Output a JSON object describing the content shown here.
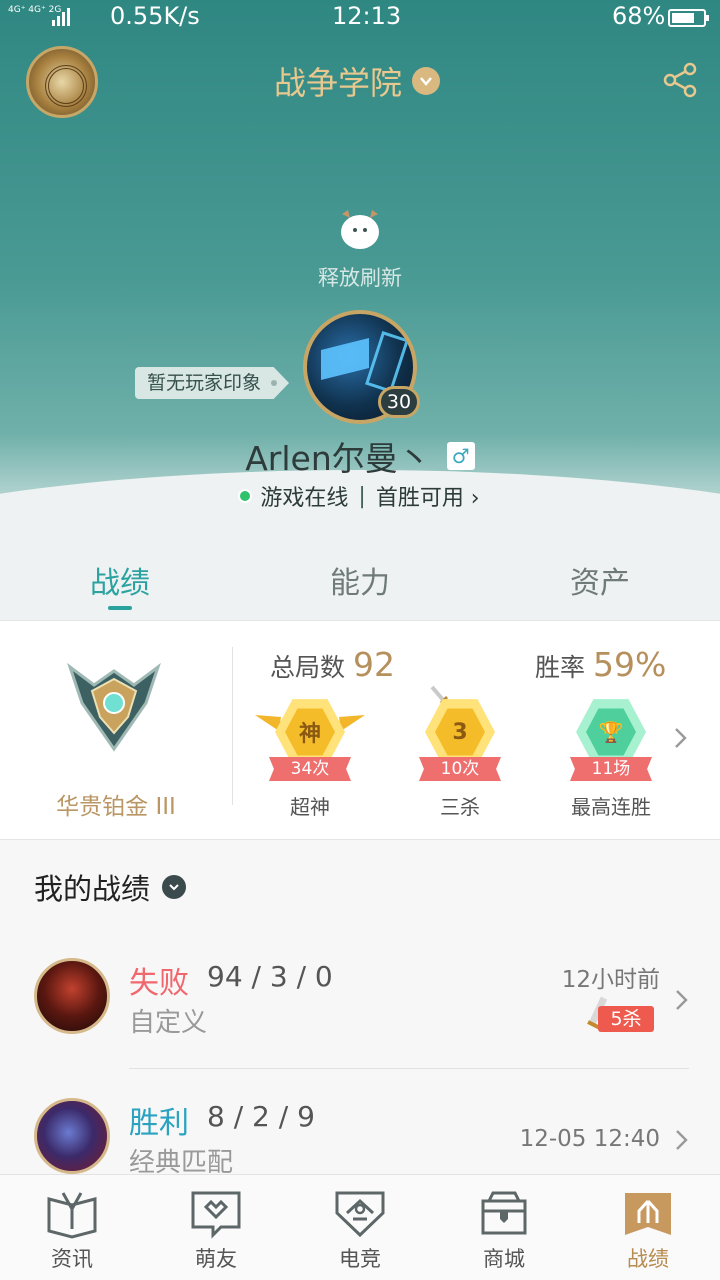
{
  "status_bar": {
    "network": "4G⁺ 4G⁺ 2G",
    "speed": "0.55K/s",
    "time": "12:13",
    "battery": "68%"
  },
  "header": {
    "title": "战争学院",
    "logo_icon": "poro-emblem-icon",
    "share_icon": "share-icon"
  },
  "refresh": {
    "text": "释放刷新"
  },
  "profile": {
    "impression_tag": "暂无玩家印象",
    "level": "30",
    "name": "Arlen尔曼丶",
    "gender_symbol": "♂",
    "online_status": "游戏在线",
    "first_win": "首胜可用 ›"
  },
  "tabs": [
    {
      "label": "战绩",
      "active": true
    },
    {
      "label": "能力",
      "active": false
    },
    {
      "label": "资产",
      "active": false
    }
  ],
  "stats": {
    "rank_name": "华贵铂金 III",
    "total_games_label": "总局数",
    "total_games_value": "92",
    "win_rate_label": "胜率",
    "win_rate_value": "59%",
    "medals": [
      {
        "symbol": "神",
        "count": "34次",
        "label": "超神",
        "color": "#f6c530"
      },
      {
        "symbol": "3",
        "count": "10次",
        "label": "三杀",
        "color": "#f6c530"
      },
      {
        "symbol": "🏆",
        "count": "11场",
        "label": "最高连胜",
        "color": "#5fd3a8"
      }
    ]
  },
  "records": {
    "title": "我的战绩",
    "items": [
      {
        "result": "失败",
        "kda": "94 / 3 / 0",
        "mode": "自定义",
        "time": "12小时前",
        "badge": "5杀"
      },
      {
        "result": "胜利",
        "kda": "8 / 2 / 9",
        "mode": "经典匹配",
        "time": "12-05 12:40"
      }
    ]
  },
  "bottom_nav": [
    {
      "label": "资讯",
      "active": false
    },
    {
      "label": "萌友",
      "active": false
    },
    {
      "label": "电竞",
      "active": false
    },
    {
      "label": "商城",
      "active": false
    },
    {
      "label": "战绩",
      "active": true
    }
  ],
  "colors": {
    "accent_teal": "#2aa2a0",
    "gold": "#b78a4f",
    "lose_red": "#f0676d",
    "win_blue": "#2aa2c0"
  }
}
